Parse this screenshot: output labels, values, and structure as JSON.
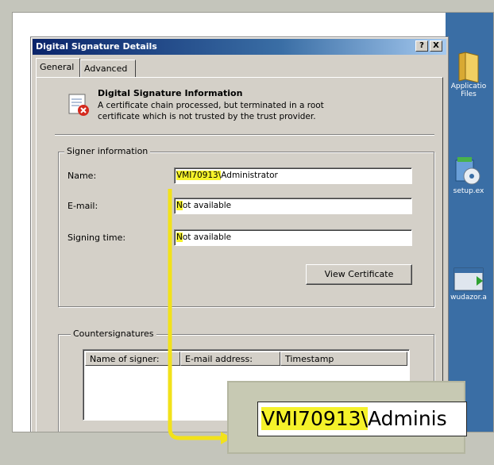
{
  "dialog": {
    "title": "Digital Signature Details",
    "help_label": "?",
    "close_label": "X",
    "tabs": [
      {
        "label": "General"
      },
      {
        "label": "Advanced"
      }
    ]
  },
  "info": {
    "heading": "Digital Signature Information",
    "line1": "A certificate chain processed, but terminated in a root",
    "line2": "certificate which is not trusted by the trust provider."
  },
  "signer": {
    "group_label": "Signer information",
    "name_label": "Name:",
    "name_highlight": "VMI70913\\",
    "name_rest": "Administrator",
    "email_label": "E-mail:",
    "email_value_highlight": "N",
    "email_value_rest": "ot available",
    "time_label": "Signing time:",
    "time_value_highlight": "N",
    "time_value_rest": "ot available",
    "view_cert_button": "View Certificate"
  },
  "counters": {
    "group_label": "Countersignatures",
    "columns": [
      "Name of signer:",
      "E-mail address:",
      "Timestamp"
    ]
  },
  "desktop": {
    "icons": [
      {
        "label1": "Applicatio",
        "label2": "Files"
      },
      {
        "label1": "setup.ex"
      },
      {
        "label1": "wudazor.a"
      }
    ]
  },
  "zoom": {
    "highlight": "VMI70913\\",
    "rest": "Adminis"
  },
  "colors": {
    "highlight": "#f5f22a",
    "arrow": "#f2e21a",
    "title_bar": "#0a246a"
  }
}
